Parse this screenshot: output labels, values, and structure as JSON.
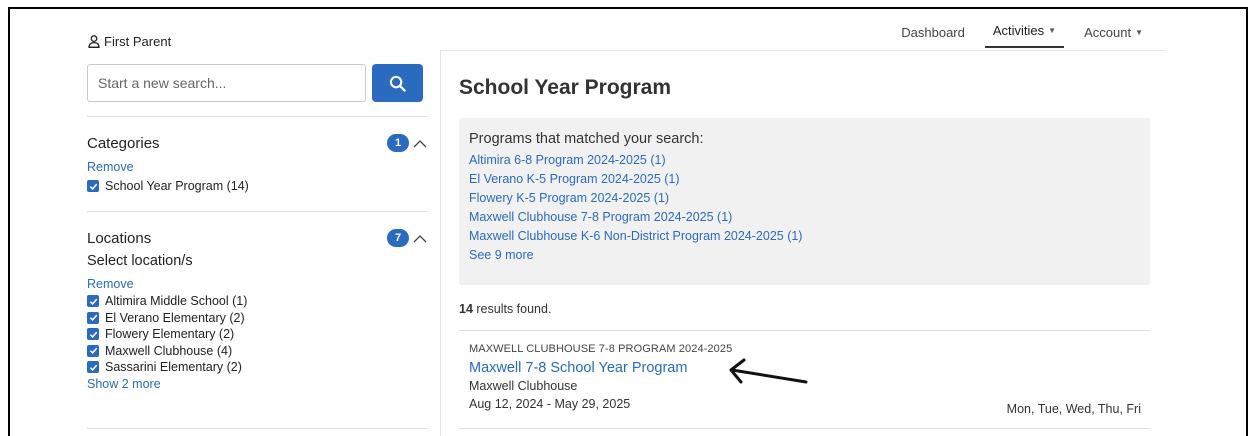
{
  "user": {
    "name": "First Parent"
  },
  "nav": {
    "dashboard": "Dashboard",
    "activities": "Activities",
    "account": "Account"
  },
  "search": {
    "placeholder": "Start a new search..."
  },
  "categories": {
    "title": "Categories",
    "count": "1",
    "remove": "Remove",
    "items": [
      {
        "label": "School Year Program (14)",
        "checked": true
      }
    ]
  },
  "locations": {
    "title": "Locations",
    "count": "7",
    "subtitle": "Select location/s",
    "remove": "Remove",
    "items": [
      {
        "label": "Altimira Middle School (1)",
        "checked": true
      },
      {
        "label": "El Verano Elementary (2)",
        "checked": true
      },
      {
        "label": "Flowery Elementary (2)",
        "checked": true
      },
      {
        "label": "Maxwell Clubhouse (4)",
        "checked": true
      },
      {
        "label": "Sassarini Elementary (2)",
        "checked": true
      }
    ],
    "show_more": "Show 2 more"
  },
  "main": {
    "title": "School Year Program",
    "matched_title": "Programs that matched your search:",
    "matched_programs": [
      "Altimira 6-8 Program 2024-2025 (1)",
      "El Verano K-5 Program 2024-2025 (1)",
      "Flowery K-5 Program 2024-2025 (1)",
      "Maxwell Clubhouse 7-8 Program 2024-2025 (1)",
      "Maxwell Clubhouse K-6 Non-District Program 2024-2025 (1)"
    ],
    "see_more": "See 9 more",
    "results_count": "14",
    "results_text": " results found."
  },
  "result_card": {
    "kicker": "MAXWELL CLUBHOUSE 7-8 PROGRAM 2024-2025",
    "title": "Maxwell 7-8 School Year Program",
    "location": "Maxwell Clubhouse",
    "dates": "Aug 12, 2024 - May 29, 2025",
    "days": "Mon, Tue, Wed, Thu, Fri"
  },
  "colors": {
    "accent": "#2a6bbf",
    "panel": "#f1f1f1"
  },
  "icons": [
    "user-icon",
    "search-icon",
    "chevron-up-icon",
    "caret-down-icon",
    "checkbox-checked-icon",
    "arrow-annotation"
  ]
}
